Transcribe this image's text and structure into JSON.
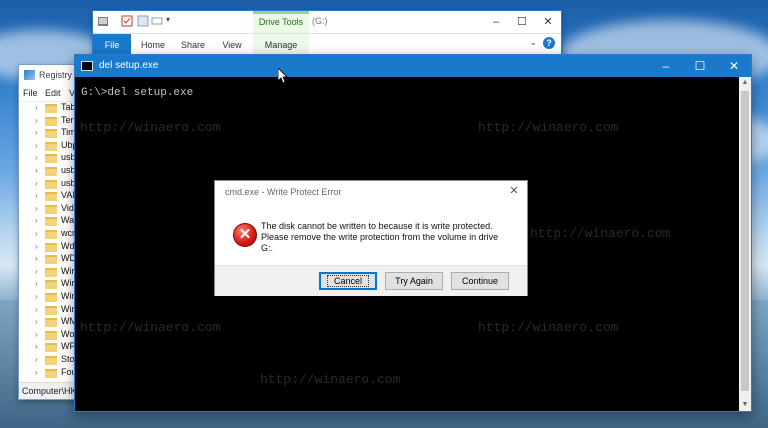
{
  "explorer": {
    "drive_tools": "Drive Tools",
    "title_drive": "(G:)",
    "tabs": [
      "File",
      "Home",
      "Share",
      "View",
      "Manage"
    ],
    "help": "?"
  },
  "regedit": {
    "title": "Registry E",
    "menu": [
      "File",
      "Edit",
      "V"
    ],
    "tree": [
      "Tabl",
      "Terr",
      "Tim",
      "Ubp",
      "usb",
      "usbf",
      "usbs",
      "VAN",
      "Vide",
      "Wal",
      "wcn",
      "Wdf",
      "WDI",
      "Win",
      "Win",
      "Win",
      "Win",
      "WM",
      "Wor",
      "WPI",
      "Stor",
      "Fours"
    ],
    "status": "Computer\\HKE"
  },
  "console": {
    "title": "del  setup.exe",
    "prompt": "G:\\>del setup.exe"
  },
  "dialog": {
    "title": "cmd.exe - Write Protect Error",
    "message": "The disk cannot be written to because it is write protected. Please remove the write protection from the volume  in drive G:.",
    "buttons": {
      "cancel": "Cancel",
      "try_again": "Try Again",
      "continue": "Continue"
    }
  },
  "watermark": "http://winaero.com",
  "colors": {
    "accent": "#1979ca",
    "console_bg": "#000000",
    "drive_tools_green": "#eafae6",
    "error_red": "#d11a10"
  }
}
